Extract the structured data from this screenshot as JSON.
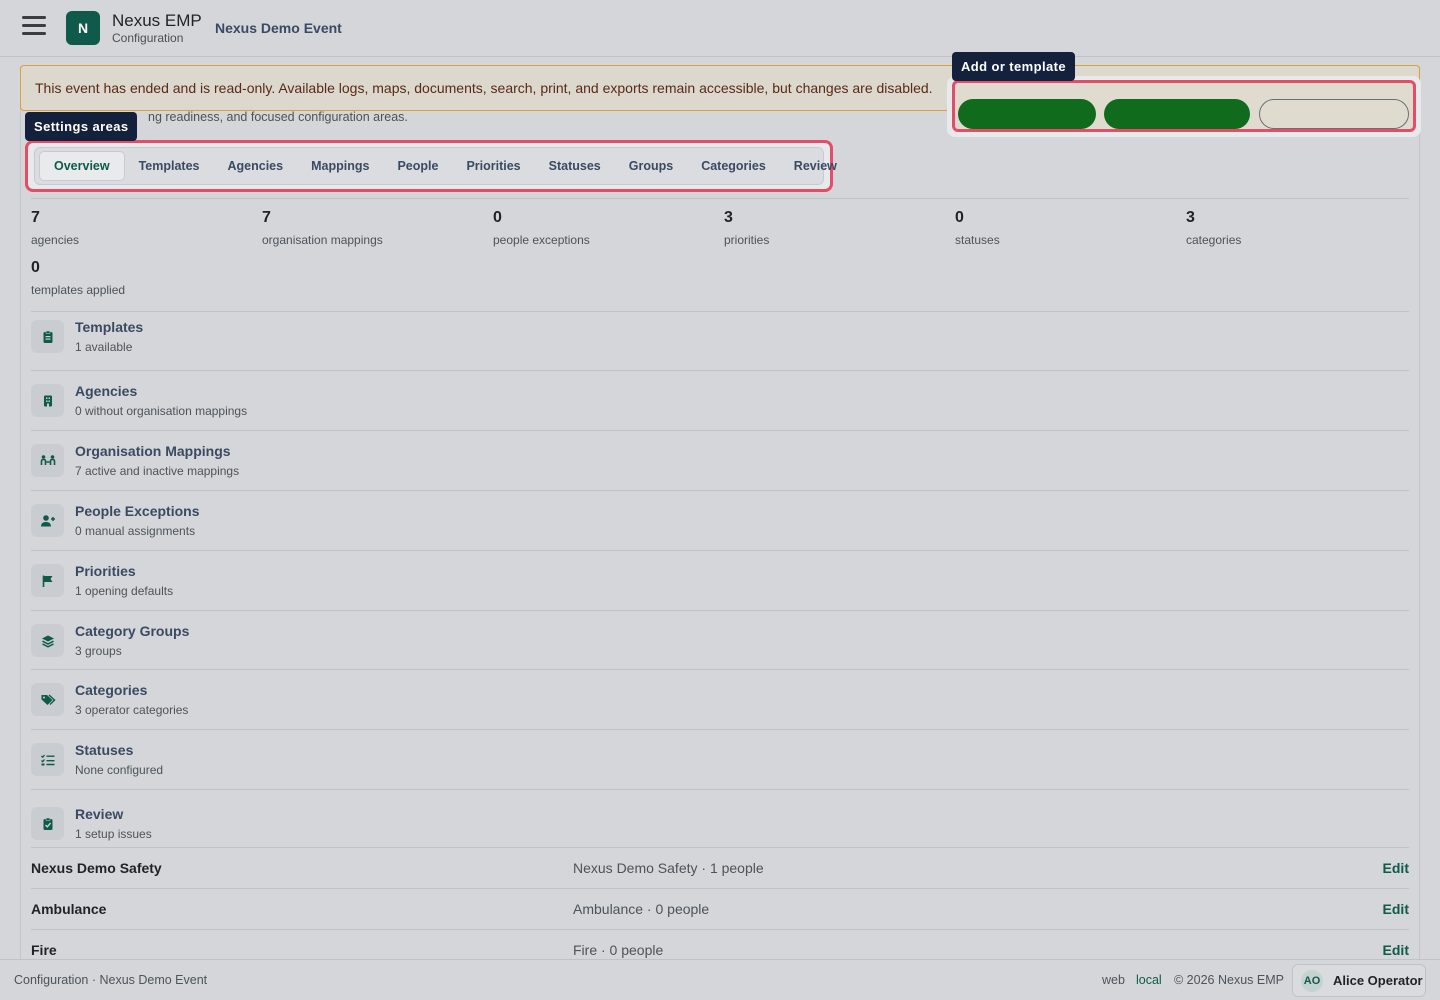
{
  "header": {
    "logo_letter": "N",
    "app_name": "Nexus EMP",
    "app_subtitle": "Configuration",
    "event_name": "Nexus Demo Event"
  },
  "banner": {
    "text": "This event has ended and is read-only. Available logs, maps, documents, search, print, and exports remain accessible, but changes are disabled."
  },
  "subtitle": "ng readiness, and focused configuration areas.",
  "tooltips": {
    "settings_areas": "Settings areas",
    "add_or_template": "Add or template"
  },
  "tabs": [
    {
      "label": "Overview",
      "active": true
    },
    {
      "label": "Templates",
      "active": false
    },
    {
      "label": "Agencies",
      "active": false
    },
    {
      "label": "Mappings",
      "active": false
    },
    {
      "label": "People",
      "active": false
    },
    {
      "label": "Priorities",
      "active": false
    },
    {
      "label": "Statuses",
      "active": false
    },
    {
      "label": "Groups",
      "active": false
    },
    {
      "label": "Categories",
      "active": false
    },
    {
      "label": "Review",
      "active": false
    }
  ],
  "stats": [
    {
      "value": "7",
      "label": "agencies"
    },
    {
      "value": "7",
      "label": "organisation mappings"
    },
    {
      "value": "0",
      "label": "people exceptions"
    },
    {
      "value": "3",
      "label": "priorities"
    },
    {
      "value": "0",
      "label": "statuses"
    },
    {
      "value": "3",
      "label": "categories"
    },
    {
      "value": "0",
      "label": "templates applied"
    }
  ],
  "areas": [
    {
      "title": "Templates",
      "subtitle": "1 available",
      "icon": "clipboard-icon"
    },
    {
      "title": "Agencies",
      "subtitle": "0 without organisation mappings",
      "icon": "building-icon"
    },
    {
      "title": "Organisation Mappings",
      "subtitle": "7 active and inactive mappings",
      "icon": "link-people-icon"
    },
    {
      "title": "People Exceptions",
      "subtitle": "0 manual assignments",
      "icon": "person-add-icon"
    },
    {
      "title": "Priorities",
      "subtitle": "1 opening defaults",
      "icon": "flag-icon"
    },
    {
      "title": "Category Groups",
      "subtitle": "3 groups",
      "icon": "layers-icon"
    },
    {
      "title": "Categories",
      "subtitle": "3 operator categories",
      "icon": "tags-icon"
    },
    {
      "title": "Statuses",
      "subtitle": "None configured",
      "icon": "checklist-icon"
    },
    {
      "title": "Review",
      "subtitle": "1 setup issues",
      "icon": "clipboard-check-icon"
    }
  ],
  "agencies": [
    {
      "name": "Nexus Demo Safety",
      "desc": "Nexus Demo Safety · 1 people",
      "action": "Edit"
    },
    {
      "name": "Ambulance",
      "desc": "Ambulance · 0 people",
      "action": "Edit"
    },
    {
      "name": "Fire",
      "desc": "Fire · 0 people",
      "action": "Edit"
    }
  ],
  "footer": {
    "left": "Configuration · Nexus Demo Event",
    "web": "web",
    "local": "local",
    "copyright": "© 2026 Nexus EMP",
    "user_initials": "AO",
    "user_name": "Alice Operator"
  },
  "colors": {
    "accent": "#0f5a4a",
    "highlight": "#e34d67",
    "banner_border": "#d9a13a",
    "tooltip_bg": "#14213d",
    "action_green": "#116b1d"
  }
}
